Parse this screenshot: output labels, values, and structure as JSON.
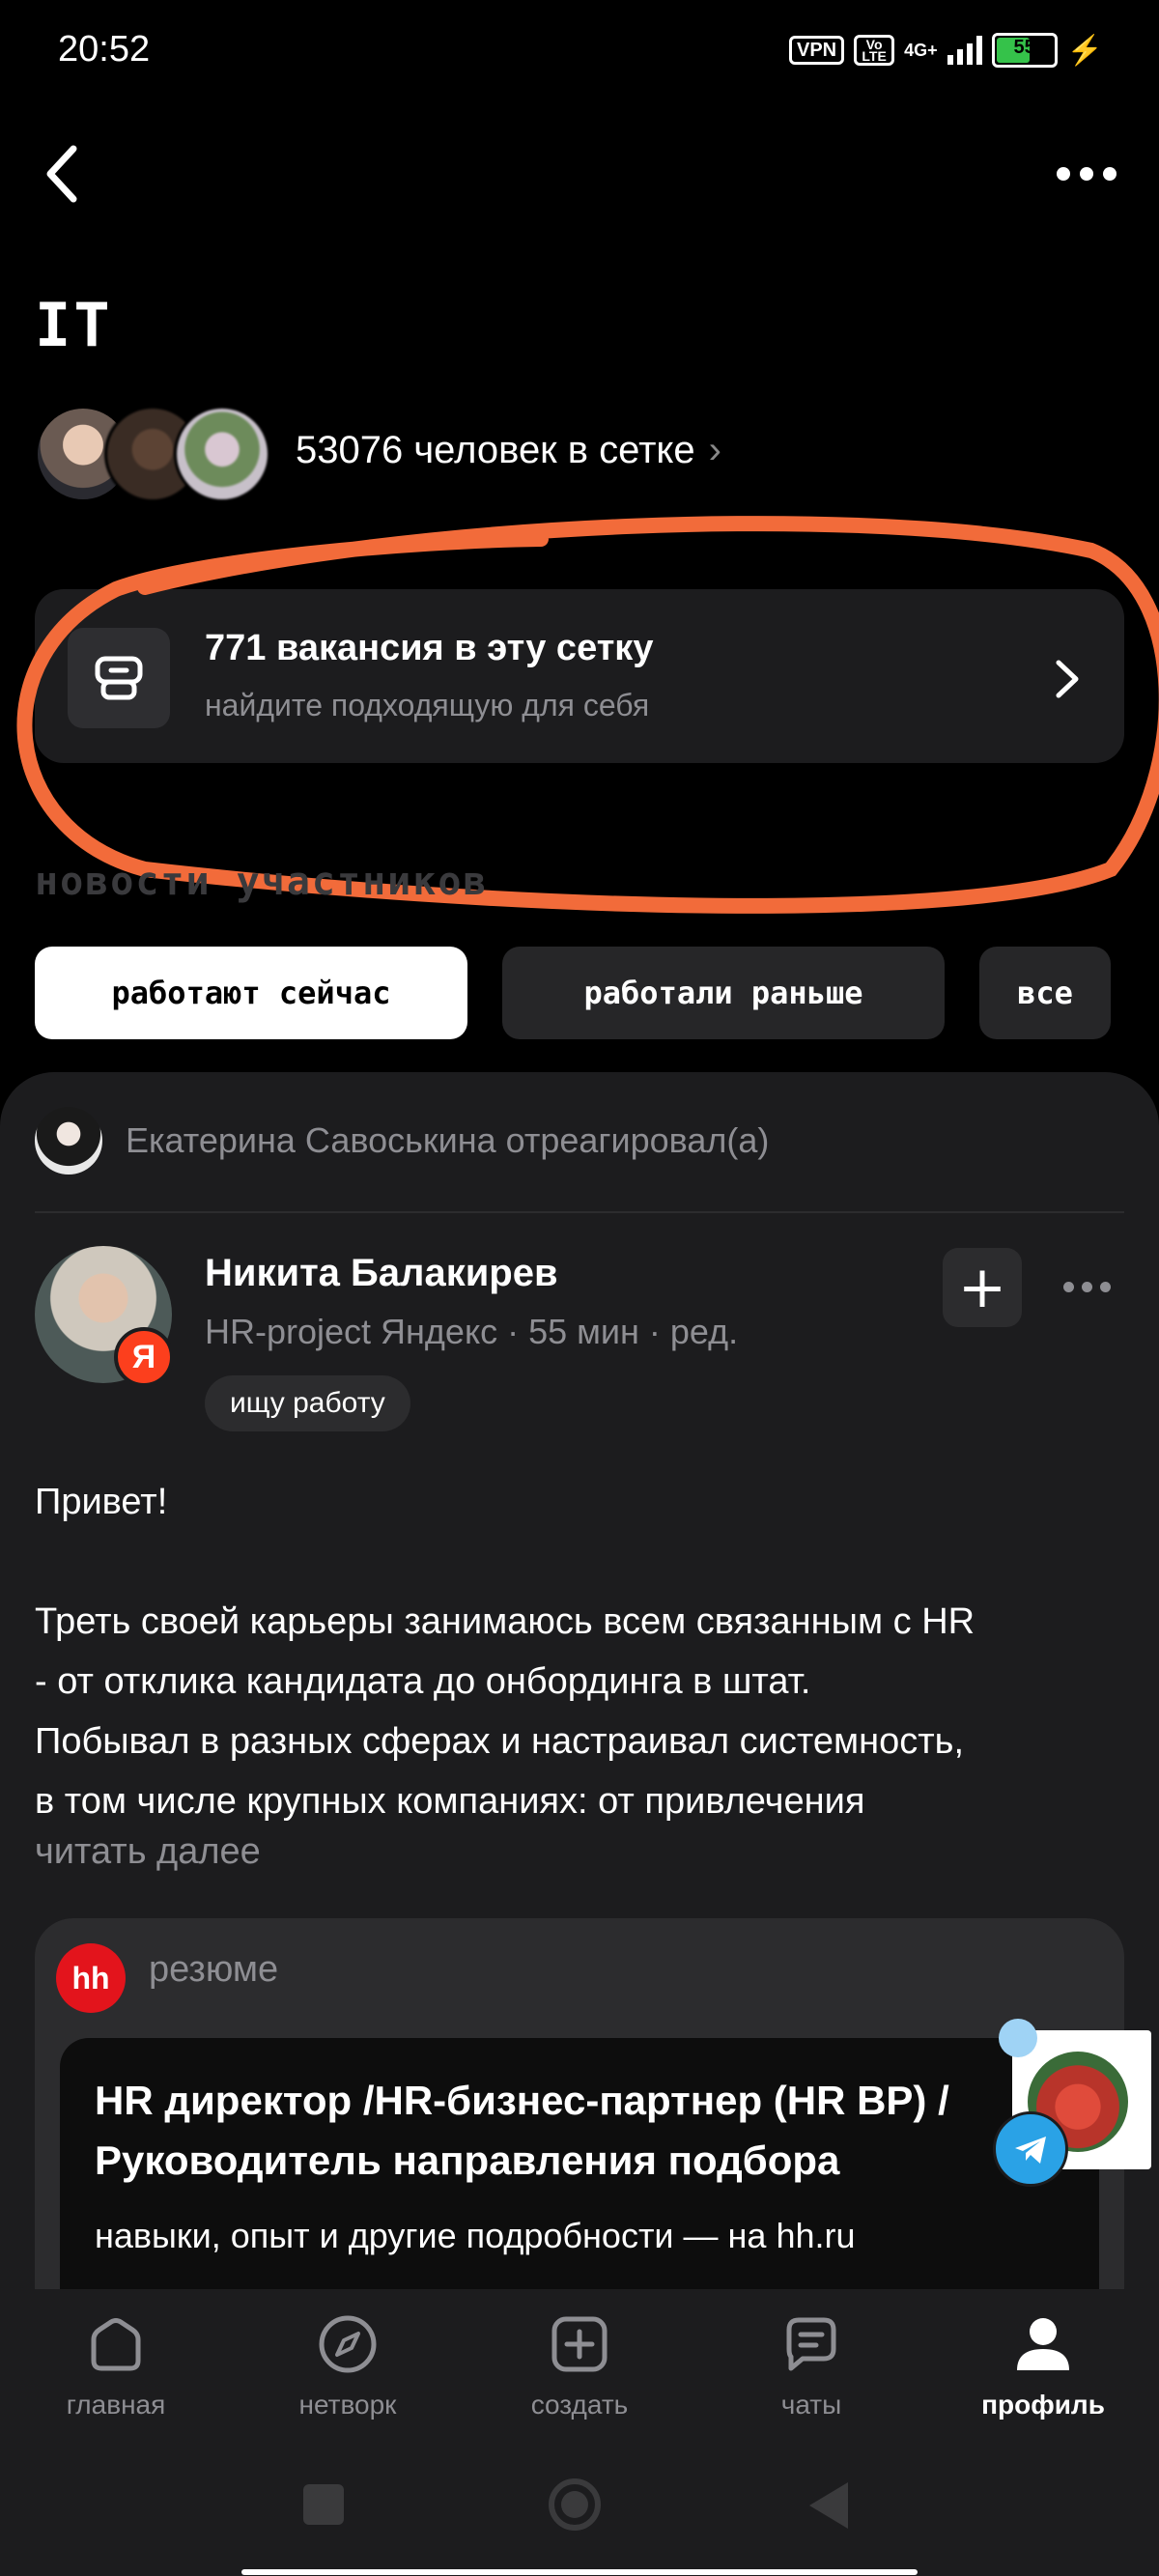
{
  "status_bar": {
    "time": "20:52",
    "vpn": "VPN",
    "volte": "Vo LTE",
    "network": "4G+",
    "battery": "55",
    "battery_level": 0.55,
    "icons": [
      "vpn-icon",
      "volte-icon",
      "signal-icon",
      "battery-icon",
      "charging-icon"
    ]
  },
  "header": {
    "title": "IT",
    "back_icon": "back-chevron-icon",
    "more_icon": "more-dots-icon"
  },
  "members": {
    "count_label": "53076 человек в сетке"
  },
  "vacancies": {
    "title": "771 вакансия в эту сетку",
    "subtitle": "найдите подходящую для себя",
    "icon": "briefcase-icon",
    "annotation_color": "#f26b3a"
  },
  "news": {
    "section_title": "новости участников",
    "filters": [
      "работают сейчас",
      "работали раньше",
      "все"
    ],
    "active_filter": "работают сейчас"
  },
  "post": {
    "reaction": "Екатерина Савоськина отреагировал(а)",
    "author_name": "Никита Балакирев",
    "author_meta": "HR-project Яндекс · 55 мин · ред.",
    "badge": "Я",
    "status_chip": "ищу работу",
    "text_lines": [
      "Привет!",
      "",
      "Треть своей карьеры занимаюсь всем связанным с HR",
      "- от отклика кандидата до онбординга в штат.",
      "Побывал в разных сферах и настраивал системность,",
      "в том числе крупных компаниях: от привлечения"
    ],
    "read_more": "читать далее"
  },
  "resume": {
    "logo": "hh",
    "label": "резюме",
    "title": "HR директор /HR-бизнес-партнер (HR BP) / Руководитель направления подбора",
    "subtitle": "навыки, опыт и другие подробности — на hh.ru"
  },
  "bottom_nav": {
    "items": [
      {
        "label": "главная",
        "icon": "home-icon"
      },
      {
        "label": "нетворк",
        "icon": "compass-icon"
      },
      {
        "label": "создать",
        "icon": "plus-square-icon"
      },
      {
        "label": "чаты",
        "icon": "chat-icon"
      },
      {
        "label": "профиль",
        "icon": "profile-icon"
      }
    ],
    "active": "профиль"
  },
  "colors": {
    "background": "#000000",
    "card": "#1c1c1e",
    "muted_text": "#8e8e93",
    "accent_hh": "#e3141c",
    "yandex": "#fc3f1d"
  }
}
